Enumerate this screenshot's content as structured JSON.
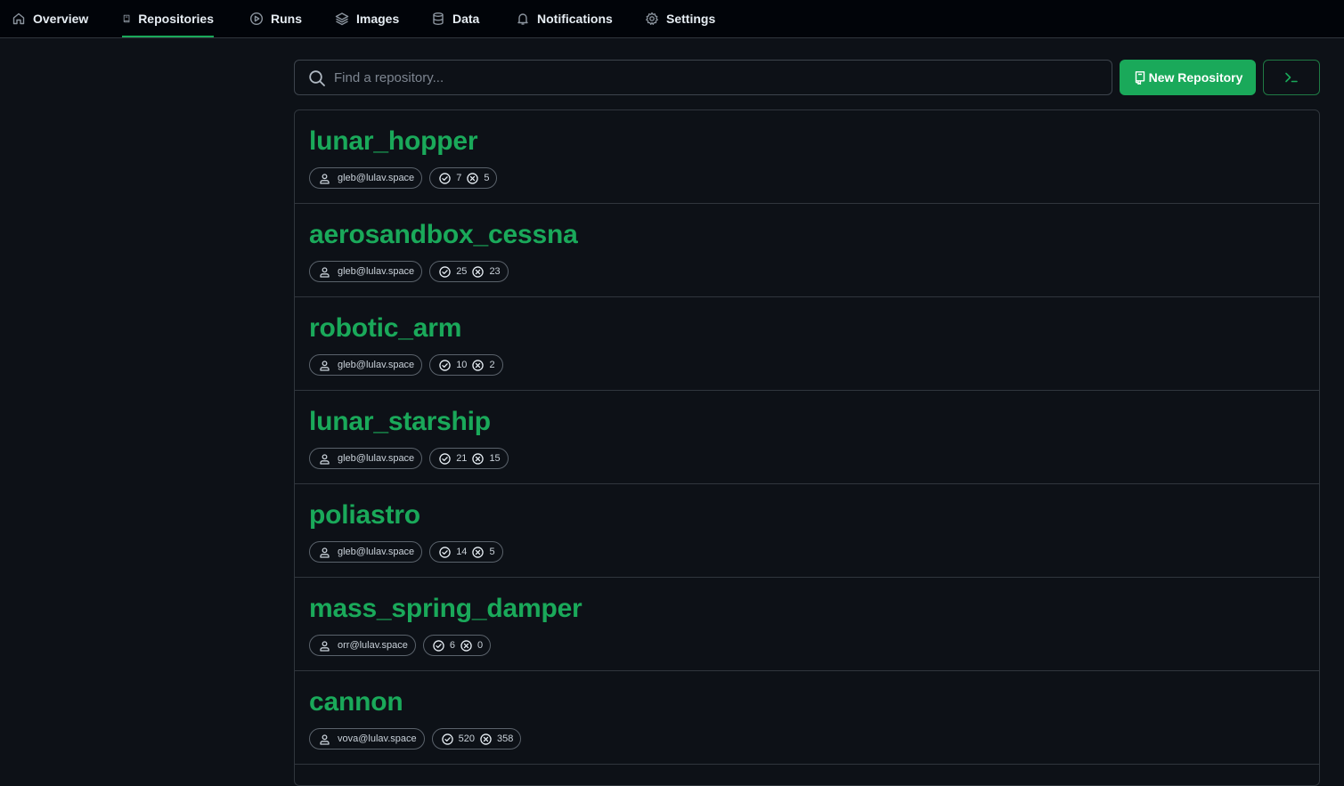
{
  "nav": {
    "items": [
      {
        "label": "Overview",
        "icon": "home-icon"
      },
      {
        "label": "Repositories",
        "icon": "repo-icon",
        "active": true
      },
      {
        "label": "Runs",
        "icon": "play-icon"
      },
      {
        "label": "Images",
        "icon": "layers-icon"
      },
      {
        "label": "Data",
        "icon": "database-icon"
      },
      {
        "label": "Notifications",
        "icon": "bell-icon"
      },
      {
        "label": "Settings",
        "icon": "gear-icon"
      }
    ]
  },
  "toolbar": {
    "search_placeholder": "Find a repository...",
    "new_repo_label": "New Repository",
    "terminal_icon": "terminal-icon"
  },
  "colors": {
    "accent": "#1aa95a",
    "background": "#0d1117",
    "nav_background": "#010409",
    "border": "#30363d"
  },
  "repos": [
    {
      "name": "lunar_hopper",
      "owner": "gleb@lulav.space",
      "passed": "7",
      "failed": "5"
    },
    {
      "name": "aerosandbox_cessna",
      "owner": "gleb@lulav.space",
      "passed": "25",
      "failed": "23"
    },
    {
      "name": "robotic_arm",
      "owner": "gleb@lulav.space",
      "passed": "10",
      "failed": "2"
    },
    {
      "name": "lunar_starship",
      "owner": "gleb@lulav.space",
      "passed": "21",
      "failed": "15"
    },
    {
      "name": "poliastro",
      "owner": "gleb@lulav.space",
      "passed": "14",
      "failed": "5"
    },
    {
      "name": "mass_spring_damper",
      "owner": "orr@lulav.space",
      "passed": "6",
      "failed": "0"
    },
    {
      "name": "cannon",
      "owner": "vova@lulav.space",
      "passed": "520",
      "failed": "358"
    }
  ]
}
